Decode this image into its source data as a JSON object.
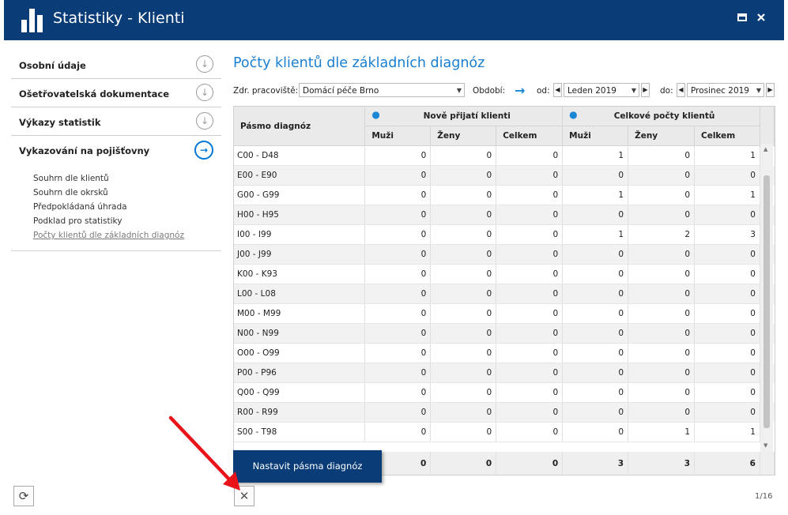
{
  "window": {
    "title": "Statistiky - Klienti"
  },
  "sidebar": {
    "sections": [
      {
        "label": "Osobní údaje"
      },
      {
        "label": "Ošetřovatelská dokumentace"
      },
      {
        "label": "Výkazy statistik"
      },
      {
        "label": "Vykazování na pojišťovny"
      }
    ],
    "subitems": [
      "Souhrn dle klientů",
      "Souhrn dle okrsků",
      "Předpokládaná úhrada",
      "Podklad pro statistiky",
      "Počty klientů dle základních diagnóz"
    ]
  },
  "main": {
    "title": "Počty klientů dle základních diagnóz",
    "filters": {
      "facility_label": "Zdr. pracoviště:",
      "facility_value": "Domácí péče Brno",
      "period_label": "Období:",
      "from_label": "od:",
      "from_value": "Leden 2019",
      "to_label": "do:",
      "to_value": "Prosinec 2019"
    },
    "table": {
      "range_header": "Pásmo diagnóz",
      "group1": "Nově přijatí klienti",
      "group2": "Celkové počty klientů",
      "sub": [
        "Muži",
        "Ženy",
        "Celkem",
        "Muži",
        "Ženy",
        "Celkem"
      ],
      "rows": [
        [
          "C00 - D48",
          "0",
          "0",
          "0",
          "1",
          "0",
          "1"
        ],
        [
          "E00 - E90",
          "0",
          "0",
          "0",
          "0",
          "0",
          "0"
        ],
        [
          "G00 - G99",
          "0",
          "0",
          "0",
          "1",
          "0",
          "1"
        ],
        [
          "H00 - H95",
          "0",
          "0",
          "0",
          "0",
          "0",
          "0"
        ],
        [
          "I00 - I99",
          "0",
          "0",
          "0",
          "1",
          "2",
          "3"
        ],
        [
          "J00 - J99",
          "0",
          "0",
          "0",
          "0",
          "0",
          "0"
        ],
        [
          "K00 - K93",
          "0",
          "0",
          "0",
          "0",
          "0",
          "0"
        ],
        [
          "L00 - L08",
          "0",
          "0",
          "0",
          "0",
          "0",
          "0"
        ],
        [
          "M00 - M99",
          "0",
          "0",
          "0",
          "0",
          "0",
          "0"
        ],
        [
          "N00 - N99",
          "0",
          "0",
          "0",
          "0",
          "0",
          "0"
        ],
        [
          "O00 - O99",
          "0",
          "0",
          "0",
          "0",
          "0",
          "0"
        ],
        [
          "P00 - P96",
          "0",
          "0",
          "0",
          "0",
          "0",
          "0"
        ],
        [
          "Q00 - Q99",
          "0",
          "0",
          "0",
          "0",
          "0",
          "0"
        ],
        [
          "R00 - R99",
          "0",
          "0",
          "0",
          "0",
          "0",
          "0"
        ],
        [
          "S00 - T98",
          "0",
          "0",
          "0",
          "0",
          "1",
          "1"
        ]
      ],
      "totals": [
        "",
        "0",
        "0",
        "0",
        "3",
        "3",
        "6"
      ]
    },
    "set_button": "Nastavit pásma diagnóz",
    "pager": "1/16"
  },
  "colors": {
    "titlebar": "#0a3d78",
    "accent": "#1a7fd1"
  }
}
